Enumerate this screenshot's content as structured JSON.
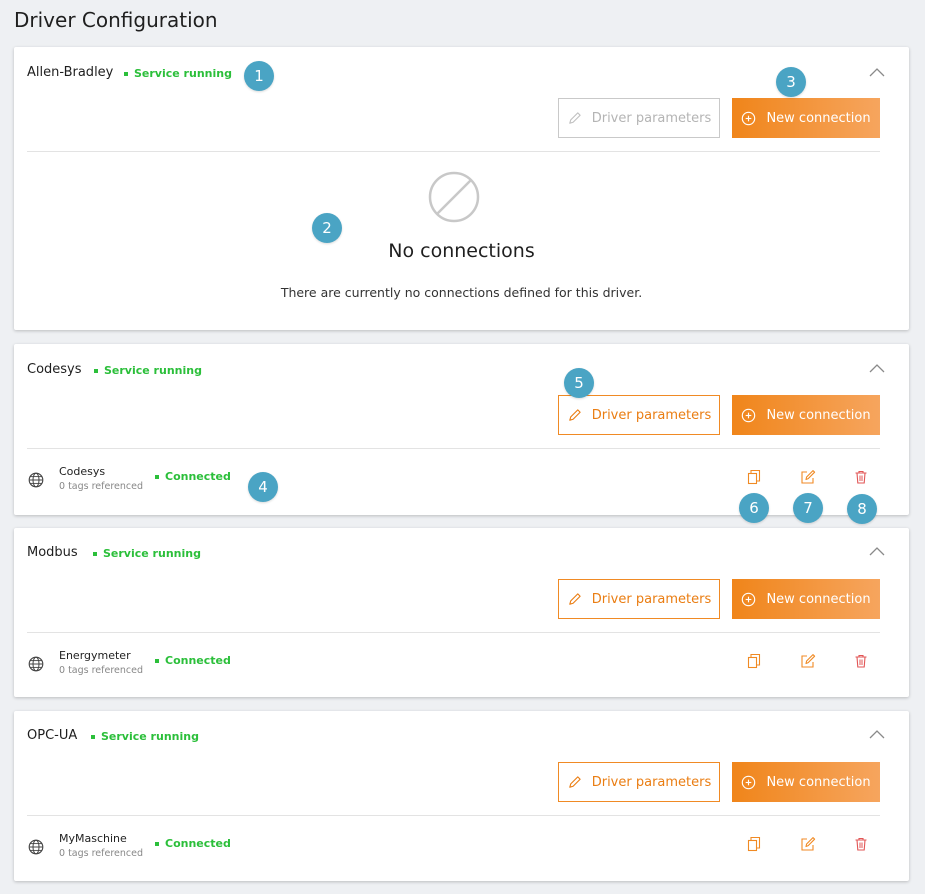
{
  "page": {
    "title": "Driver Configuration"
  },
  "buttons": {
    "driver_parameters": "Driver parameters",
    "new_connection": "New connection"
  },
  "drivers": [
    {
      "name": "Allen-Bradley",
      "status": "Service running",
      "params_enabled": false,
      "empty_state": {
        "title": "No connections",
        "text": "There are currently no connections defined for this driver."
      },
      "connections": []
    },
    {
      "name": "Codesys",
      "status": "Service running",
      "params_enabled": true,
      "connections": [
        {
          "name": "Codesys",
          "tags": "0 tags referenced",
          "status": "Connected"
        }
      ]
    },
    {
      "name": "Modbus",
      "status": "Service running",
      "params_enabled": true,
      "connections": [
        {
          "name": "Energymeter",
          "tags": "0 tags referenced",
          "status": "Connected"
        }
      ]
    },
    {
      "name": "OPC-UA",
      "status": "Service running",
      "params_enabled": true,
      "connections": [
        {
          "name": "MyMaschine",
          "tags": "0 tags referenced",
          "status": "Connected"
        }
      ]
    }
  ],
  "markers": [
    "1",
    "2",
    "3",
    "4",
    "5",
    "6",
    "7",
    "8"
  ],
  "colors": {
    "accent": "#f0851a",
    "status_green": "#2bbf3a",
    "marker": "#4aa4c4",
    "delete": "#e25555"
  },
  "icons": {
    "collapse": "chevron-up-icon",
    "params": "pencil-icon",
    "new": "plus-circle-icon",
    "empty": "no-entry-icon",
    "connection": "globe-icon",
    "copy": "copy-icon",
    "edit": "edit-icon",
    "delete": "trash-icon"
  }
}
